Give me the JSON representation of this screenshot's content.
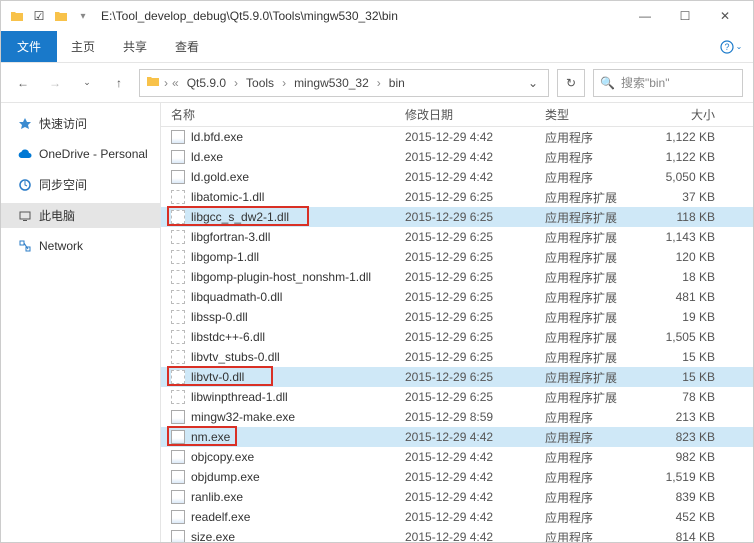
{
  "titlebar": {
    "path": "E:\\Tool_develop_debug\\Qt5.9.0\\Tools\\mingw530_32\\bin"
  },
  "menubar": {
    "file": "文件",
    "home": "主页",
    "share": "共享",
    "view": "查看"
  },
  "breadcrumbs": [
    "Qt5.9.0",
    "Tools",
    "mingw530_32",
    "bin"
  ],
  "search": {
    "placeholder": "搜索\"bin\""
  },
  "sidebar": {
    "items": [
      {
        "label": "快速访问",
        "icon": "star-icon",
        "color": "#3b8bd0"
      },
      {
        "label": "OneDrive - Personal",
        "icon": "cloud-icon",
        "color": "#0078d4"
      },
      {
        "label": "同步空间",
        "icon": "sync-icon",
        "color": "#2b7cc7"
      },
      {
        "label": "此电脑",
        "icon": "pc-icon",
        "color": "#555",
        "selected": true
      },
      {
        "label": "Network",
        "icon": "network-icon",
        "color": "#2b7cc7"
      }
    ]
  },
  "columns": {
    "name": "名称",
    "date": "修改日期",
    "type": "类型",
    "size": "大小"
  },
  "highlighted_rows": [
    4,
    12,
    15
  ],
  "files": [
    {
      "name": "ld.bfd.exe",
      "date": "2015-12-29 4:42",
      "type": "应用程序",
      "size": "1,122 KB",
      "icon": "exe"
    },
    {
      "name": "ld.exe",
      "date": "2015-12-29 4:42",
      "type": "应用程序",
      "size": "1,122 KB",
      "icon": "exe"
    },
    {
      "name": "ld.gold.exe",
      "date": "2015-12-29 4:42",
      "type": "应用程序",
      "size": "5,050 KB",
      "icon": "exe"
    },
    {
      "name": "libatomic-1.dll",
      "date": "2015-12-29 6:25",
      "type": "应用程序扩展",
      "size": "37 KB",
      "icon": "dll"
    },
    {
      "name": "libgcc_s_dw2-1.dll",
      "date": "2015-12-29 6:25",
      "type": "应用程序扩展",
      "size": "118 KB",
      "icon": "dll"
    },
    {
      "name": "libgfortran-3.dll",
      "date": "2015-12-29 6:25",
      "type": "应用程序扩展",
      "size": "1,143 KB",
      "icon": "dll"
    },
    {
      "name": "libgomp-1.dll",
      "date": "2015-12-29 6:25",
      "type": "应用程序扩展",
      "size": "120 KB",
      "icon": "dll"
    },
    {
      "name": "libgomp-plugin-host_nonshm-1.dll",
      "date": "2015-12-29 6:25",
      "type": "应用程序扩展",
      "size": "18 KB",
      "icon": "dll"
    },
    {
      "name": "libquadmath-0.dll",
      "date": "2015-12-29 6:25",
      "type": "应用程序扩展",
      "size": "481 KB",
      "icon": "dll"
    },
    {
      "name": "libssp-0.dll",
      "date": "2015-12-29 6:25",
      "type": "应用程序扩展",
      "size": "19 KB",
      "icon": "dll"
    },
    {
      "name": "libstdc++-6.dll",
      "date": "2015-12-29 6:25",
      "type": "应用程序扩展",
      "size": "1,505 KB",
      "icon": "dll"
    },
    {
      "name": "libvtv_stubs-0.dll",
      "date": "2015-12-29 6:25",
      "type": "应用程序扩展",
      "size": "15 KB",
      "icon": "dll"
    },
    {
      "name": "libvtv-0.dll",
      "date": "2015-12-29 6:25",
      "type": "应用程序扩展",
      "size": "15 KB",
      "icon": "dll"
    },
    {
      "name": "libwinpthread-1.dll",
      "date": "2015-12-29 6:25",
      "type": "应用程序扩展",
      "size": "78 KB",
      "icon": "dll"
    },
    {
      "name": "mingw32-make.exe",
      "date": "2015-12-29 8:59",
      "type": "应用程序",
      "size": "213 KB",
      "icon": "exe"
    },
    {
      "name": "nm.exe",
      "date": "2015-12-29 4:42",
      "type": "应用程序",
      "size": "823 KB",
      "icon": "exe"
    },
    {
      "name": "objcopy.exe",
      "date": "2015-12-29 4:42",
      "type": "应用程序",
      "size": "982 KB",
      "icon": "exe"
    },
    {
      "name": "objdump.exe",
      "date": "2015-12-29 4:42",
      "type": "应用程序",
      "size": "1,519 KB",
      "icon": "exe"
    },
    {
      "name": "ranlib.exe",
      "date": "2015-12-29 4:42",
      "type": "应用程序",
      "size": "839 KB",
      "icon": "exe"
    },
    {
      "name": "readelf.exe",
      "date": "2015-12-29 4:42",
      "type": "应用程序",
      "size": "452 KB",
      "icon": "exe"
    },
    {
      "name": "size.exe",
      "date": "2015-12-29 4:42",
      "type": "应用程序",
      "size": "814 KB",
      "icon": "exe"
    }
  ]
}
